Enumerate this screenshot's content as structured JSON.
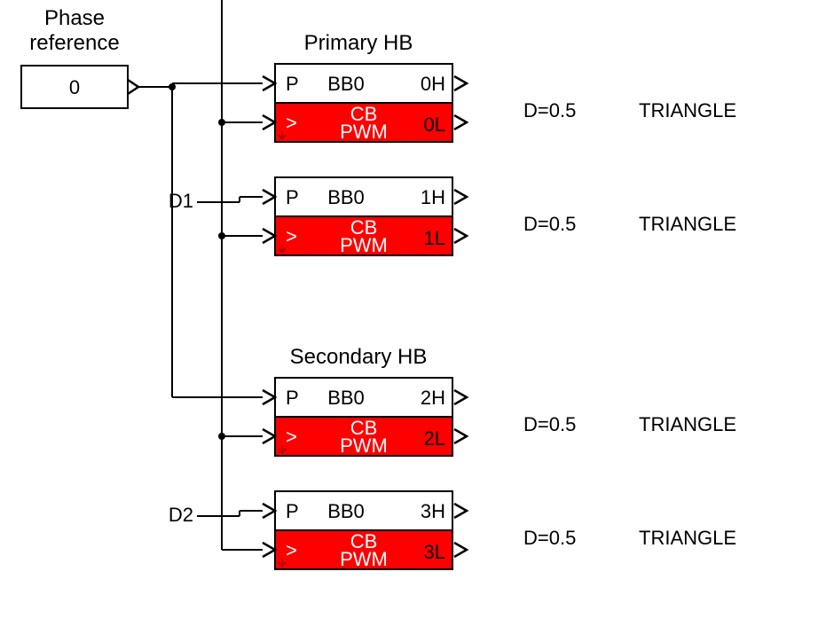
{
  "phase_ref": {
    "label_line1": "Phase",
    "label_line2": "reference",
    "value": "0"
  },
  "primary_hb": {
    "title": "Primary HB",
    "d_label": "D1"
  },
  "secondary_hb": {
    "title": "Secondary HB",
    "d_label": "D2"
  },
  "blocks": [
    {
      "p": "P",
      "bb": "BB0",
      "hi": "0H",
      "lo": "0L",
      "cb": "CB",
      "pwm": "PWM",
      "gt": ">",
      "note_d": "D=0.5",
      "note_w": "TRIANGLE"
    },
    {
      "p": "P",
      "bb": "BB0",
      "hi": "1H",
      "lo": "1L",
      "cb": "CB",
      "pwm": "PWM",
      "gt": ">",
      "note_d": "D=0.5",
      "note_w": "TRIANGLE"
    },
    {
      "p": "P",
      "bb": "BB0",
      "hi": "2H",
      "lo": "2L",
      "cb": "CB",
      "pwm": "PWM",
      "gt": ">",
      "note_d": "D=0.5",
      "note_w": "TRIANGLE"
    },
    {
      "p": "P",
      "bb": "BB0",
      "hi": "3H",
      "lo": "3L",
      "cb": "CB",
      "pwm": "PWM",
      "gt": ">",
      "note_d": "D=0.5",
      "note_w": "TRIANGLE"
    }
  ]
}
